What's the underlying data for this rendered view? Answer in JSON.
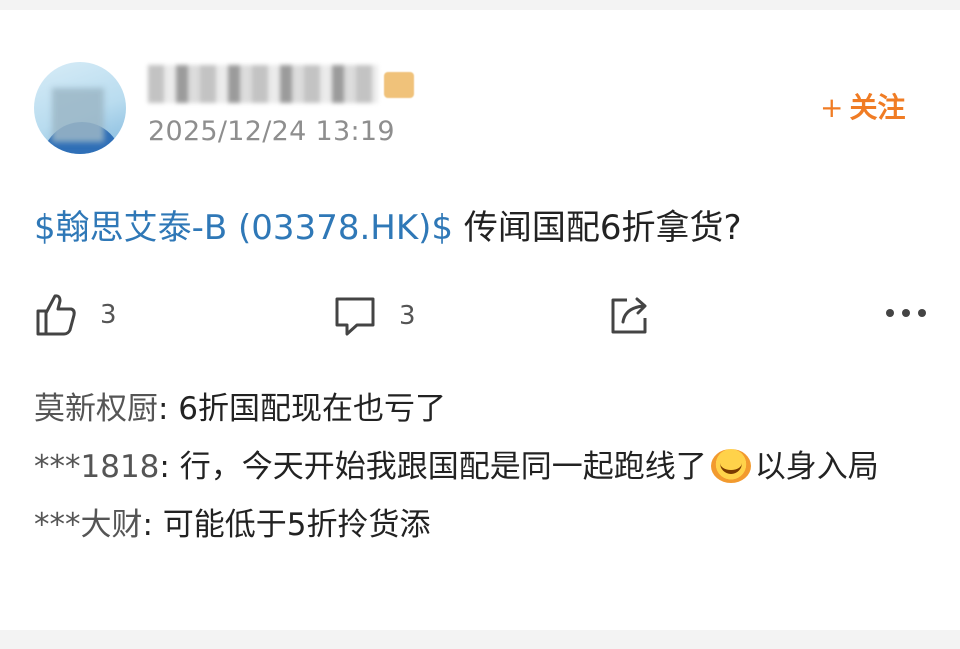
{
  "post": {
    "author_name": "",
    "timestamp": "2025/12/24 13:19",
    "follow_label": "关注",
    "stock_tag": "$翰思艾泰-B (03378.HK)$",
    "content": " 传闻国配6折拿货?"
  },
  "actions": {
    "like_count": "3",
    "comment_count": "3"
  },
  "comments": [
    {
      "author": "莫新权厨",
      "text": ": 6折国配现在也亏了"
    },
    {
      "author": "***1818",
      "text": ": 行，今天开始我跟国配是同一起跑线了",
      "emoji": "laughing-crying-emoji",
      "text_after": "以身入局"
    },
    {
      "author": "***大财",
      "text": ": 可能低于5折拎货添"
    }
  ],
  "colors": {
    "accent_orange": "#f07c24",
    "stock_link_blue": "#2f78b7"
  },
  "icons": [
    "thumbs-up-icon",
    "comment-bubble-icon",
    "share-icon",
    "more-dots-icon"
  ]
}
